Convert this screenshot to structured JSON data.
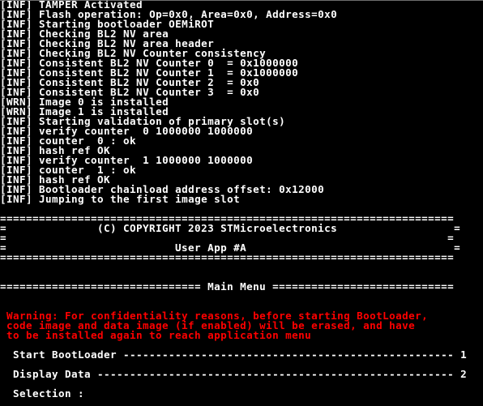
{
  "log": [
    {
      "tag": "[INF]",
      "text": "TAMPER Activated"
    },
    {
      "tag": "[INF]",
      "text": "Flash operation: Op=0x0, Area=0x0, Address=0x0"
    },
    {
      "tag": "[INF]",
      "text": "Starting bootloader OEMiROT"
    },
    {
      "tag": "[INF]",
      "text": "Checking BL2 NV area"
    },
    {
      "tag": "[INF]",
      "text": "Checking BL2 NV area header"
    },
    {
      "tag": "[INF]",
      "text": "Checking BL2 NV Counter consistency"
    },
    {
      "tag": "[INF]",
      "text": "Consistent BL2 NV Counter 0  = 0x1000000"
    },
    {
      "tag": "[INF]",
      "text": "Consistent BL2 NV Counter 1  = 0x1000000"
    },
    {
      "tag": "[INF]",
      "text": "Consistent BL2 NV Counter 2  = 0x0"
    },
    {
      "tag": "[INF]",
      "text": "Consistent BL2 NV Counter 3  = 0x0"
    },
    {
      "tag": "[WRN]",
      "text": "Image 0 is installed"
    },
    {
      "tag": "[WRN]",
      "text": "Image 1 is installed"
    },
    {
      "tag": "[INF]",
      "text": "Starting validation of primary slot(s)"
    },
    {
      "tag": "[INF]",
      "text": "verify counter  0 1000000 1000000"
    },
    {
      "tag": "[INF]",
      "text": "counter  0 : ok"
    },
    {
      "tag": "[INF]",
      "text": "hash ref OK"
    },
    {
      "tag": "[INF]",
      "text": "verify counter  1 1000000 1000000"
    },
    {
      "tag": "[INF]",
      "text": "counter  1 : ok"
    },
    {
      "tag": "[INF]",
      "text": "hash ref OK"
    },
    {
      "tag": "[INF]",
      "text": "Bootloader chainload address offset: 0x12000"
    },
    {
      "tag": "[INF]",
      "text": "Jumping to the first image slot"
    }
  ],
  "banner": {
    "border": "======================================================================",
    "copyright_line": "=              (C) COPYRIGHT 2023 STMicroelectronics                  =",
    "empty_line": "=                                                                    =",
    "app_line": "=                          User App #A                                =",
    "copyright": "(C) COPYRIGHT 2023 STMicroelectronics",
    "app_title": "User App #A"
  },
  "menu": {
    "header_line": "=============================== Main Menu ============================",
    "title": "Main Menu",
    "warning": [
      " Warning: For confidentiality reasons, before starting BootLoader,",
      " code image and data image (if enabled) will be erased, and have",
      " to be installed again to reach application menu"
    ],
    "items": [
      {
        "line": "  Start BootLoader --------------------------------------------------- 1",
        "label": "Start BootLoader",
        "key": "1"
      },
      {
        "line": "  Display Data ------------------------------------------------------- 2",
        "label": "Display Data",
        "key": "2"
      }
    ],
    "prompt": "  Selection : "
  },
  "colors": {
    "background": "#000000",
    "text": "#ffffff",
    "warning": "#ff0000"
  }
}
